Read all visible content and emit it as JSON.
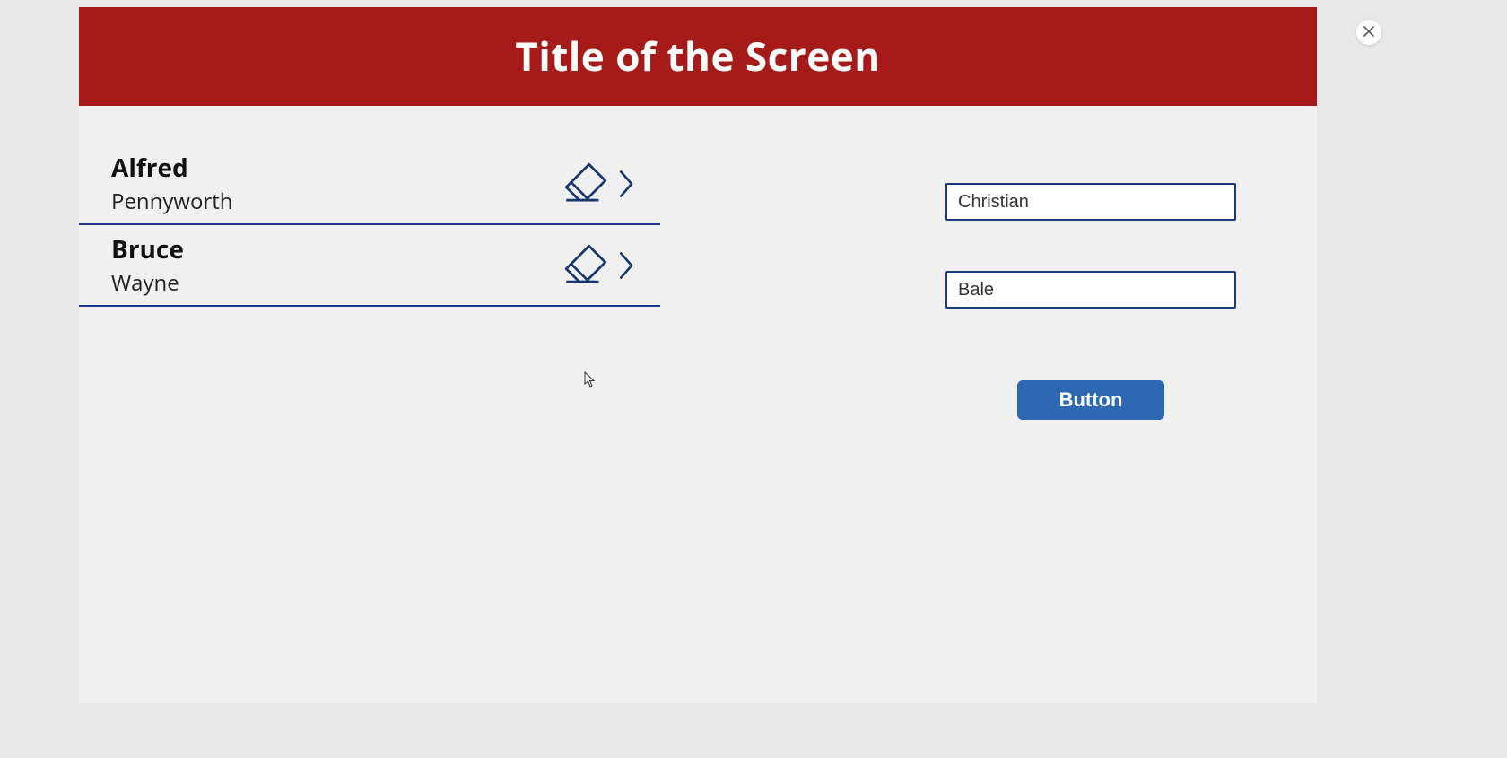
{
  "header": {
    "title": "Title of the Screen"
  },
  "list": {
    "items": [
      {
        "first": "Alfred",
        "last": "Pennyworth"
      },
      {
        "first": "Bruce",
        "last": "Wayne"
      }
    ]
  },
  "form": {
    "input1_value": "Christian",
    "input2_value": "Bale",
    "button_label": "Button"
  },
  "icons": {
    "eraser": "eraser-icon",
    "chevron": "chevron-right-icon",
    "close": "close-icon"
  },
  "colors": {
    "header_bg": "#a71a1a",
    "border": "#1d3a8a",
    "button_bg": "#2e68b3"
  }
}
